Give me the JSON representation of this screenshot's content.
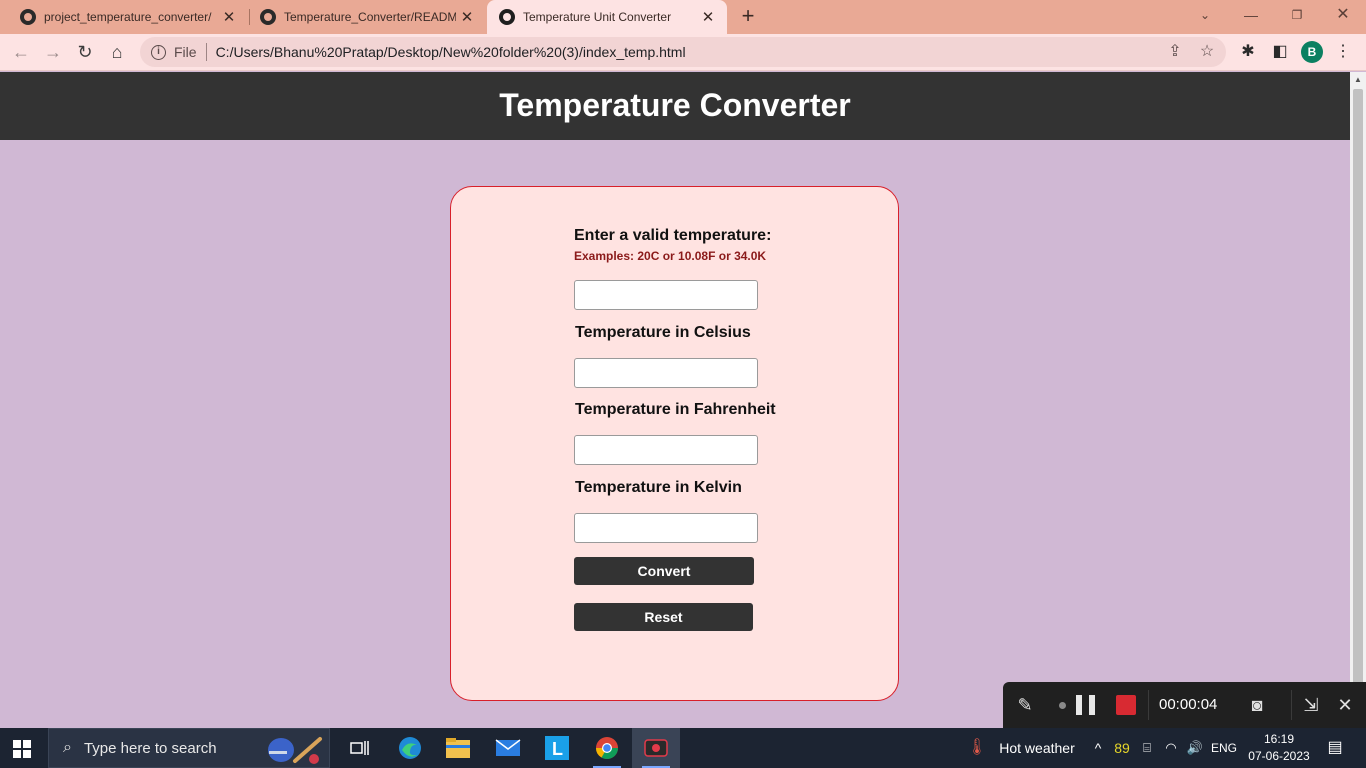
{
  "browser": {
    "tabs": [
      {
        "title": "project_temperature_converter/",
        "active": false
      },
      {
        "title": "Temperature_Converter/README",
        "active": false
      },
      {
        "title": "Temperature Unit Converter",
        "active": true
      }
    ],
    "scheme_label": "File",
    "url": "C:/Users/Bhanu%20Pratap/Desktop/New%20folder%20(3)/index_temp.html",
    "avatar_letter": "B"
  },
  "page": {
    "header_title": "Temperature Converter",
    "prompt_label": "Enter a valid temperature:",
    "prompt_hint": "Examples: 20C or 10.08F or 34.0K",
    "input_value": "",
    "celsius_label": "Temperature in Celsius",
    "celsius_value": "",
    "fahrenheit_label": "Temperature in Fahrenheit",
    "fahrenheit_value": "",
    "kelvin_label": "Temperature in Kelvin",
    "kelvin_value": "",
    "convert_label": "Convert",
    "reset_label": "Reset"
  },
  "recorder": {
    "elapsed": "00:00:04"
  },
  "taskbar": {
    "search_placeholder": "Type here to search",
    "weather_text": "Hot weather",
    "notification_count": "89",
    "language": "ENG",
    "time": "16:19",
    "date": "07-06-2023"
  },
  "colors": {
    "header_bg": "#333333",
    "page_bg": "#d0b8d4",
    "card_bg": "#ffe3e1",
    "card_border": "#d81f2a",
    "hint_text": "#8b1a1a",
    "tabstrip_bg": "#e9a995"
  }
}
